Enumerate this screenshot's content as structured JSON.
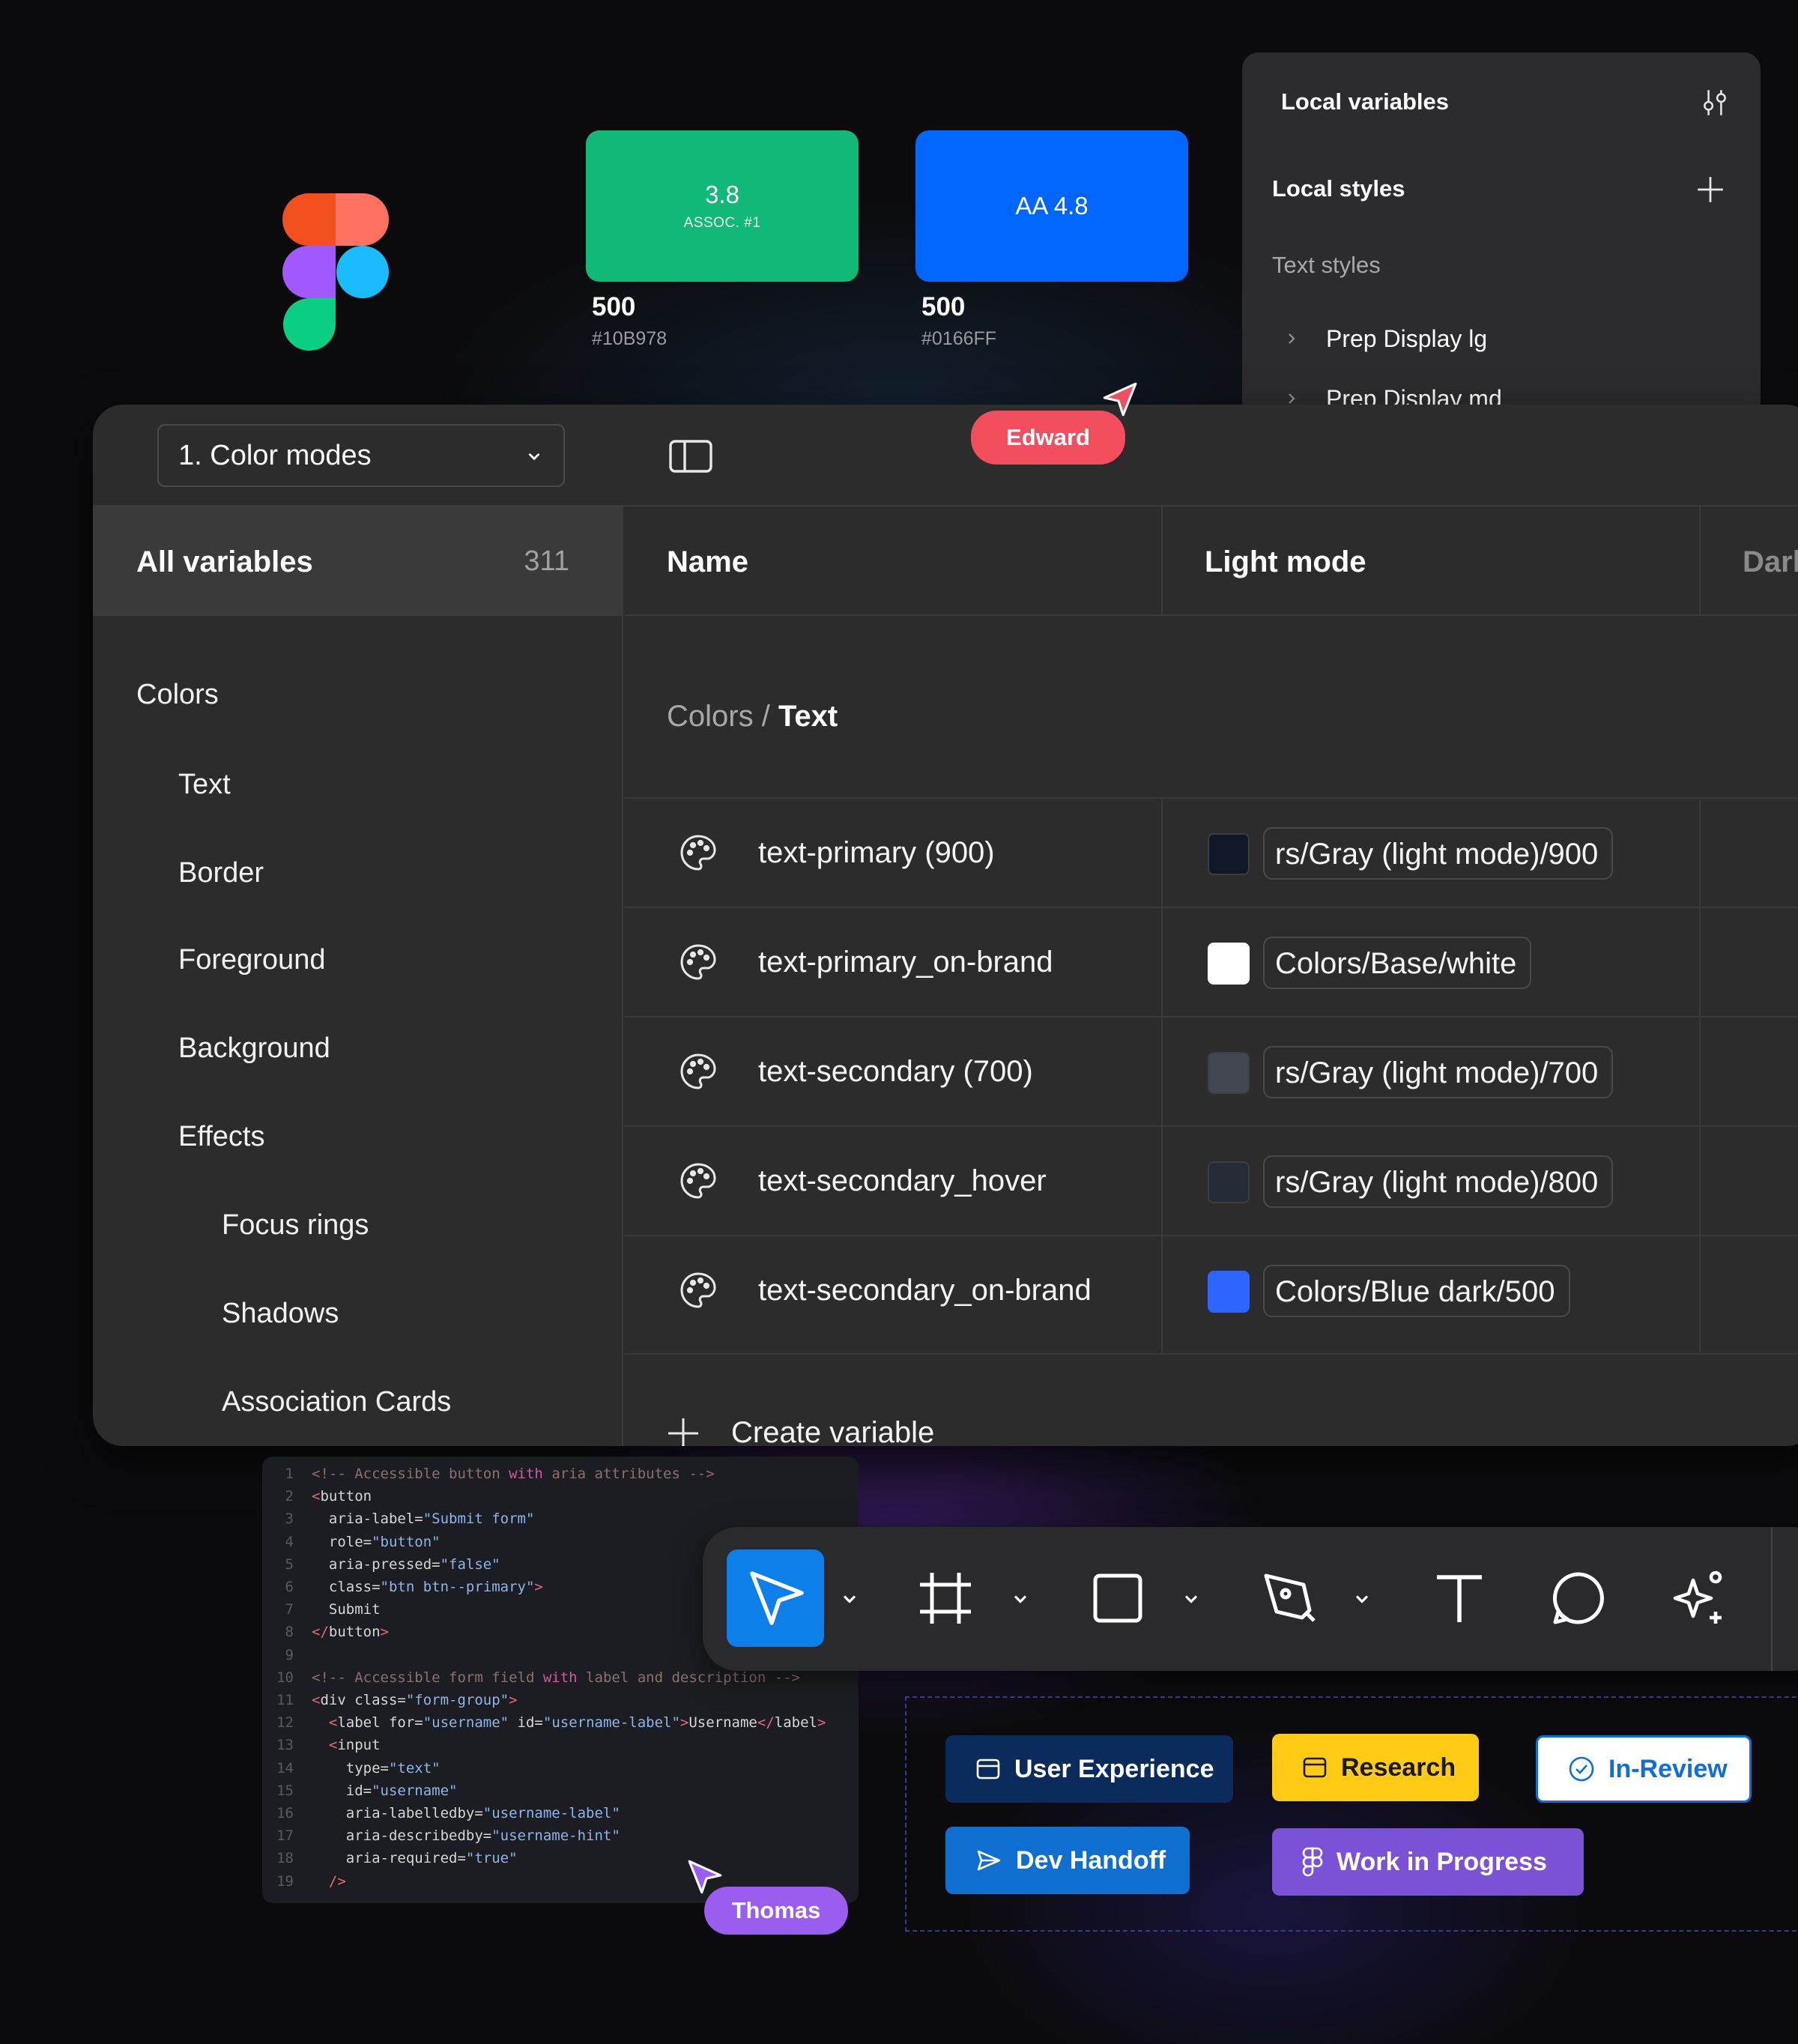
{
  "swatches": [
    {
      "value": "3.8",
      "label": "ASSOC. #1",
      "weight": "500",
      "hex": "#10B978",
      "color": "#10B978"
    },
    {
      "value": "AA 4.8",
      "label": "",
      "weight": "500",
      "hex": "#0166FF",
      "color": "#0166FF"
    }
  ],
  "styles_panel": {
    "local_variables": "Local variables",
    "local_styles": "Local styles",
    "text_styles": "Text styles",
    "items": [
      "Prep Display lg",
      "Prep Display md"
    ]
  },
  "cursors": {
    "edward": {
      "name": "Edward",
      "color": "#F24E5E"
    },
    "thomas": {
      "name": "Thomas",
      "color": "#9B5CF0"
    }
  },
  "variables_window": {
    "mode_select": "1. Color modes",
    "all_variables_label": "All variables",
    "all_variables_count": "311",
    "categories": [
      {
        "label": "Colors",
        "level": 0
      },
      {
        "label": "Text",
        "level": 1
      },
      {
        "label": "Border",
        "level": 1
      },
      {
        "label": "Foreground",
        "level": 1
      },
      {
        "label": "Background",
        "level": 1
      },
      {
        "label": "Effects",
        "level": 1
      },
      {
        "label": "Focus rings",
        "level": 2
      },
      {
        "label": "Shadows",
        "level": 2
      },
      {
        "label": "Association Cards",
        "level": 2
      }
    ],
    "columns": {
      "name": "Name",
      "light": "Light mode",
      "dark": "Dark mode"
    },
    "breadcrumb": {
      "parent": "Colors",
      "separator": "/",
      "current": "Text"
    },
    "rows": [
      {
        "name": "text-primary (900)",
        "light_swatch": "#101828",
        "light_value": "rs/Gray (light mode)/900",
        "dark_swatch": "#F5F5F6"
      },
      {
        "name": "text-primary_on-brand",
        "light_swatch": "#FFFFFF",
        "light_value": "Colors/Base/white",
        "dark_swatch": "#F5F5F6"
      },
      {
        "name": "text-secondary (700)",
        "light_swatch": "#414651",
        "light_value": "rs/Gray (light mode)/700",
        "dark_swatch": "#CECFD2"
      },
      {
        "name": "text-secondary_hover",
        "light_swatch": "#252B37",
        "light_value": "rs/Gray (light mode)/800",
        "dark_swatch": "#ECECED"
      },
      {
        "name": "text-secondary_on-brand",
        "light_swatch": "#2E64FF",
        "light_value": "Colors/Blue dark/500",
        "dark_swatch": "#CECFD2"
      }
    ],
    "create_variable": "Create variable"
  },
  "code": [
    {
      "n": "1",
      "parts": [
        [
          "c-com",
          "<!-- Accessible button "
        ],
        [
          "c-kw",
          "with"
        ],
        [
          "c-com",
          " aria attributes -->"
        ]
      ]
    },
    {
      "n": "2",
      "parts": [
        [
          "c-tag",
          "<"
        ],
        [
          "",
          "button"
        ]
      ]
    },
    {
      "n": "3",
      "parts": [
        [
          "",
          "  aria-label="
        ],
        [
          "c-str",
          "\"Submit form\""
        ]
      ]
    },
    {
      "n": "4",
      "parts": [
        [
          "",
          "  role="
        ],
        [
          "c-str",
          "\"button\""
        ]
      ]
    },
    {
      "n": "5",
      "parts": [
        [
          "",
          "  aria-pressed="
        ],
        [
          "c-str",
          "\"false\""
        ]
      ]
    },
    {
      "n": "6",
      "parts": [
        [
          "",
          "  class="
        ],
        [
          "c-str",
          "\"btn btn--primary\""
        ],
        [
          "c-tag",
          ">"
        ]
      ]
    },
    {
      "n": "7",
      "parts": [
        [
          "",
          "  Submit"
        ]
      ]
    },
    {
      "n": "8",
      "parts": [
        [
          "c-tag",
          "</"
        ],
        [
          "",
          "button"
        ],
        [
          "c-tag",
          ">"
        ]
      ]
    },
    {
      "n": "9",
      "parts": [
        [
          "",
          ""
        ]
      ]
    },
    {
      "n": "10",
      "parts": [
        [
          "c-com",
          "<!-- Accessible form field "
        ],
        [
          "c-kw",
          "with"
        ],
        [
          "c-com",
          " label and description -->"
        ]
      ]
    },
    {
      "n": "11",
      "parts": [
        [
          "c-tag",
          "<"
        ],
        [
          "",
          "div class="
        ],
        [
          "c-str",
          "\"form-group\""
        ],
        [
          "c-tag",
          ">"
        ]
      ]
    },
    {
      "n": "12",
      "parts": [
        [
          "c-tag",
          "  <"
        ],
        [
          "",
          "label for="
        ],
        [
          "c-str",
          "\"username\""
        ],
        [
          "",
          " id="
        ],
        [
          "c-str",
          "\"username-label\""
        ],
        [
          "c-tag",
          ">"
        ],
        [
          "",
          "Username"
        ],
        [
          "c-tag",
          "</"
        ],
        [
          "",
          "label"
        ],
        [
          "c-tag",
          ">"
        ]
      ]
    },
    {
      "n": "13",
      "parts": [
        [
          "c-tag",
          "  <"
        ],
        [
          "",
          "input"
        ]
      ]
    },
    {
      "n": "14",
      "parts": [
        [
          "",
          "    type="
        ],
        [
          "c-str",
          "\"text\""
        ]
      ]
    },
    {
      "n": "15",
      "parts": [
        [
          "",
          "    id="
        ],
        [
          "c-str",
          "\"username\""
        ]
      ]
    },
    {
      "n": "16",
      "parts": [
        [
          "",
          "    aria-labelledby="
        ],
        [
          "c-str",
          "\"username-label\""
        ]
      ]
    },
    {
      "n": "17",
      "parts": [
        [
          "",
          "    aria-describedby="
        ],
        [
          "c-str",
          "\"username-hint\""
        ]
      ]
    },
    {
      "n": "18",
      "parts": [
        [
          "",
          "    aria-required="
        ],
        [
          "c-str",
          "\"true\""
        ]
      ]
    },
    {
      "n": "19",
      "parts": [
        [
          "c-tag",
          "  />"
        ]
      ]
    }
  ],
  "toolbar": {
    "tools": [
      "move-tool",
      "frame-tool",
      "shape-tool",
      "pen-tool",
      "text-tool",
      "comment-tool",
      "ai-tool"
    ],
    "active": "move-tool",
    "accent": "#0D7FE8"
  },
  "chips": [
    {
      "label": "User Experience",
      "icon": "window-icon",
      "bg": "#0B2B5C",
      "fg": "#FFFFFF"
    },
    {
      "label": "Research",
      "icon": "window-icon",
      "bg": "#FFCB14",
      "fg": "#1A1A1A"
    },
    {
      "label": "In-Review",
      "icon": "check-circle-icon",
      "bg": "#FFFFFF",
      "fg": "#0D6EDC"
    },
    {
      "label": "Dev Handoff",
      "icon": "send-icon",
      "bg": "#0F6FD1",
      "fg": "#FFFFFF"
    },
    {
      "label": "Work in Progress",
      "icon": "figma-icon",
      "bg": "#7B52D6",
      "fg": "#FFFFFF"
    }
  ]
}
